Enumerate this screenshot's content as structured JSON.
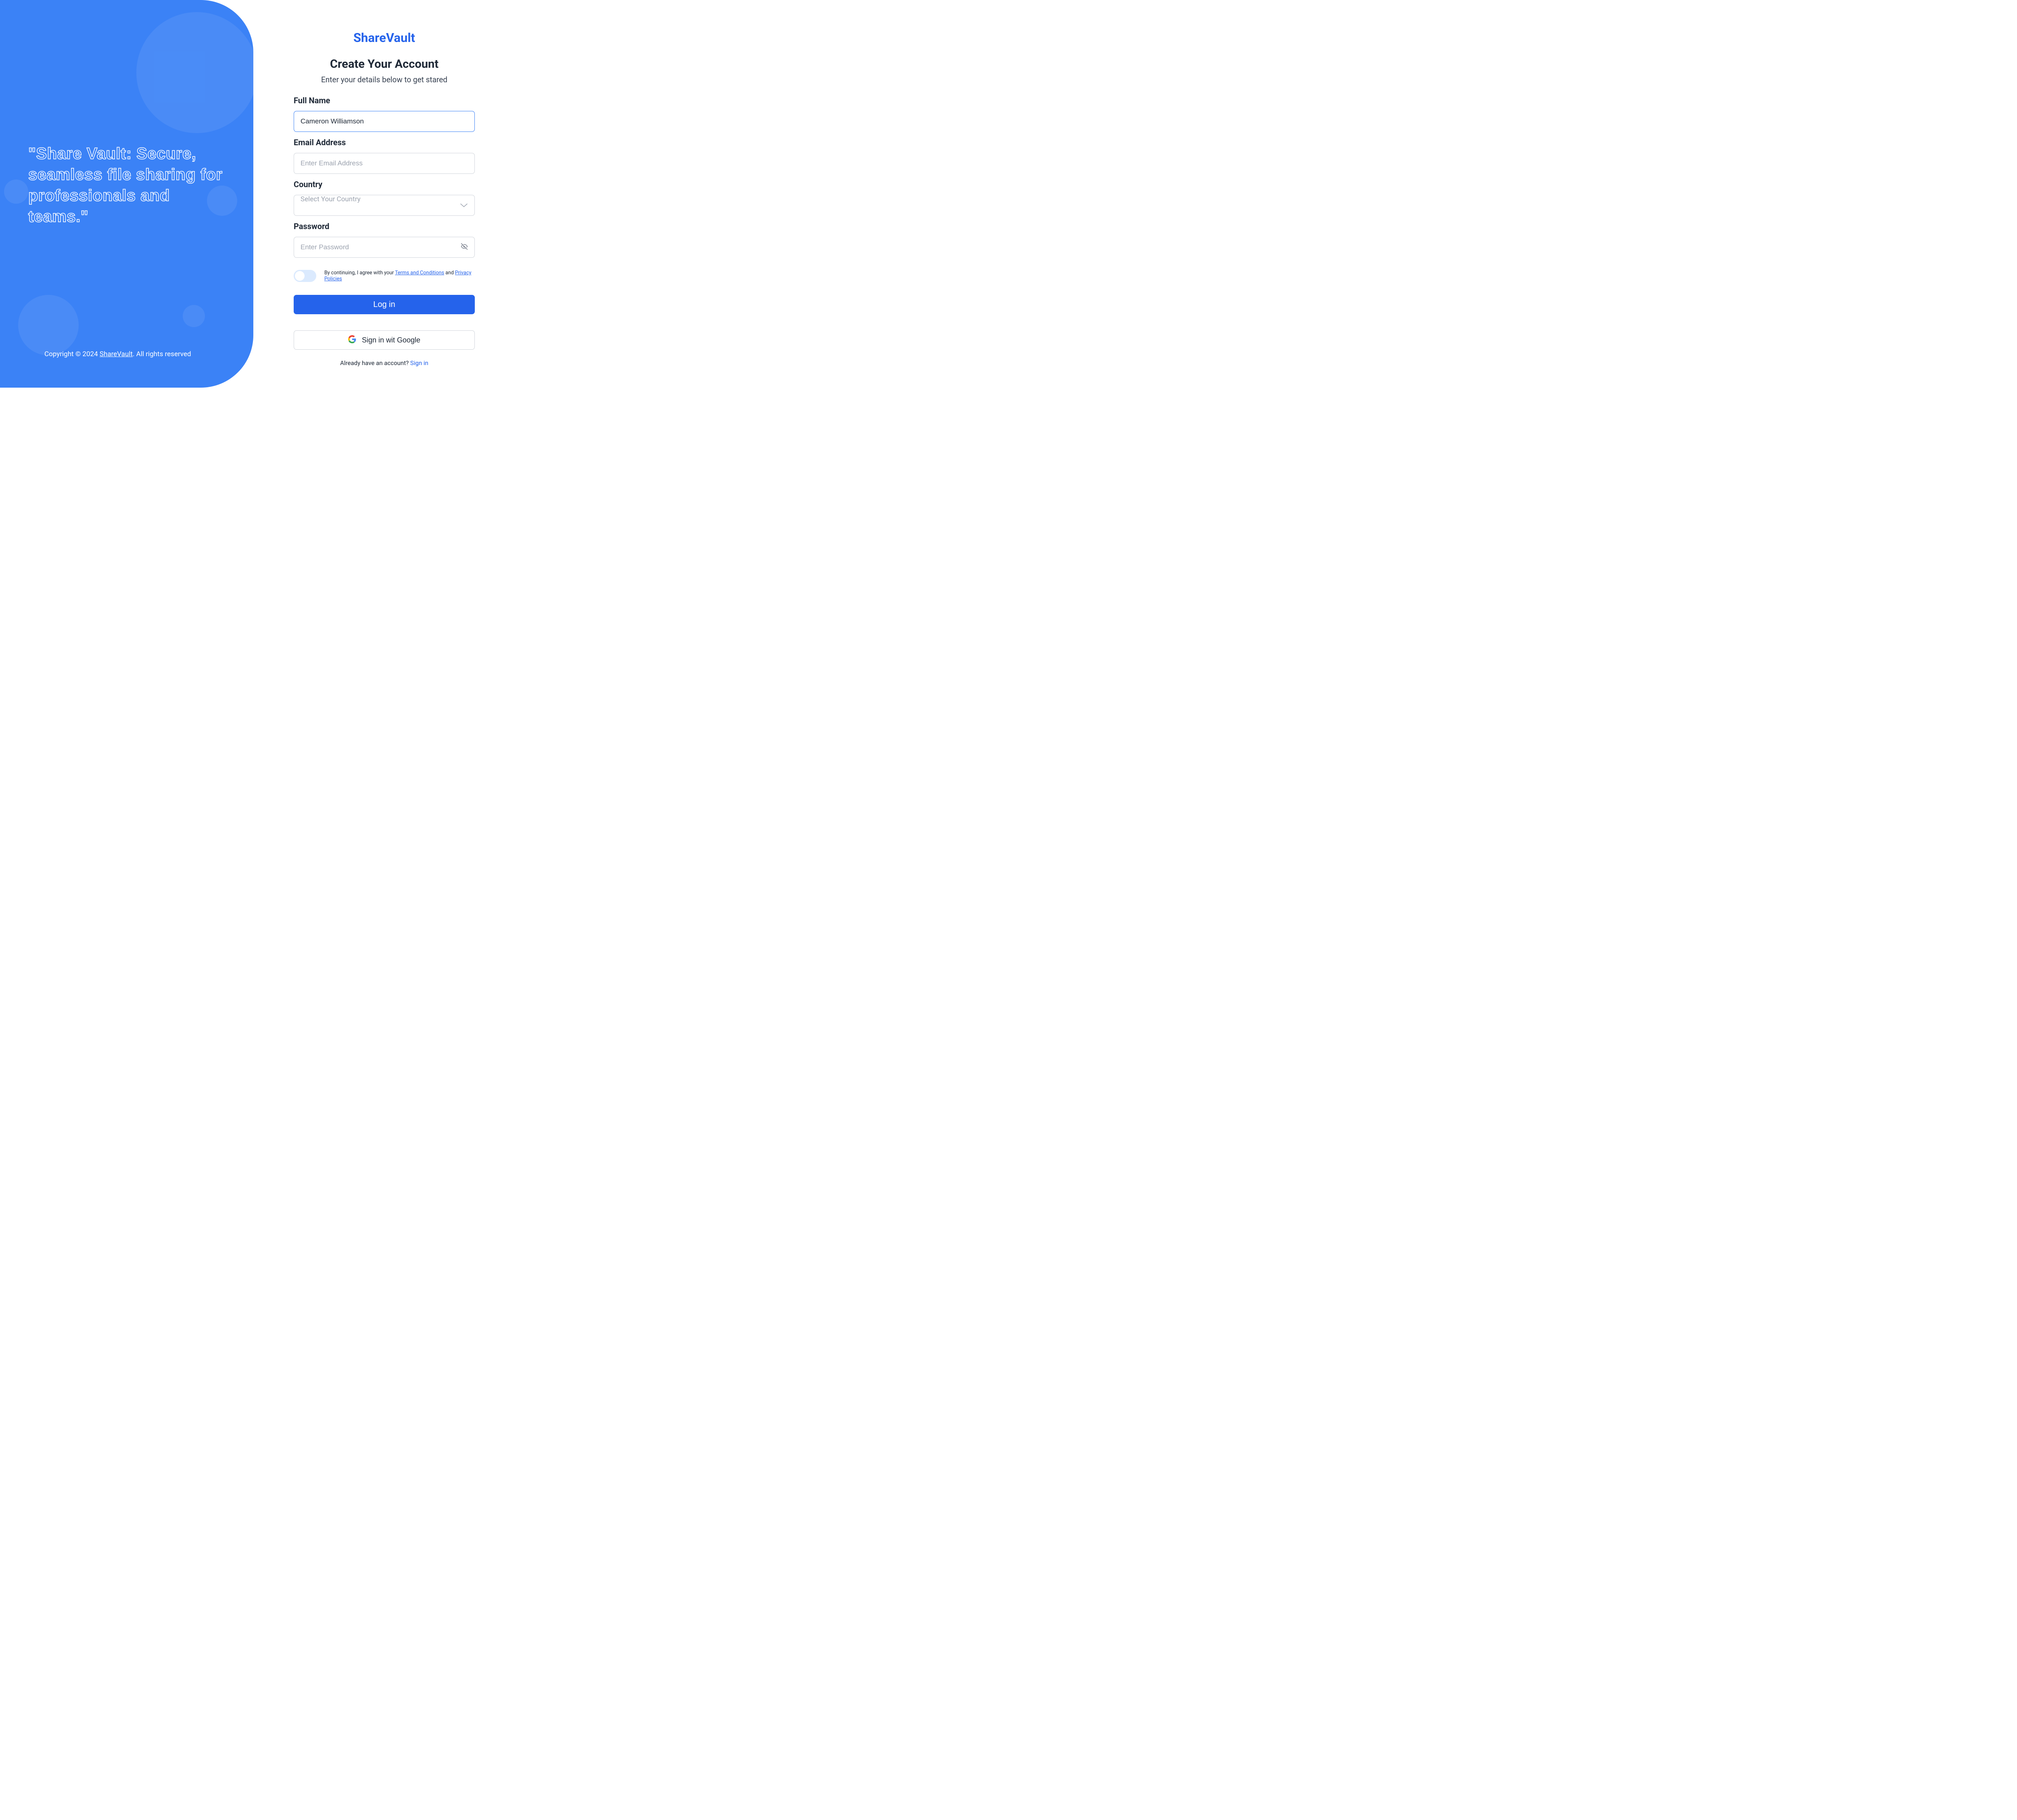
{
  "hero": {
    "tagline": "\"Share Vault: Secure, seamless file sharing for professionals and teams.\"",
    "copyright_prefix": "Copyright © 2024 ",
    "brand": "ShareVault",
    "copyright_suffix": ". All rights reserved"
  },
  "form": {
    "logo": "ShareVault",
    "heading": "Create Your Account",
    "subheading": "Enter your details below to get stared",
    "labels": {
      "fullname": "Full Name",
      "email": "Email Address",
      "country": "Country",
      "password": "Password"
    },
    "values": {
      "fullname": "Cameron Williamson",
      "email": "",
      "password": ""
    },
    "placeholders": {
      "email": "Enter Email Address",
      "country": "Select Your Country",
      "password": "Enter Password"
    },
    "terms": {
      "prefix": "By continuing, I agree with your ",
      "tac": "Terms and Conditions",
      "and": " and ",
      "pp": "Privacy Policies"
    },
    "buttons": {
      "login": "Log in",
      "google": "Sign in wit Google"
    },
    "already": {
      "text": "Already have an account? ",
      "link": "Sign in"
    }
  }
}
